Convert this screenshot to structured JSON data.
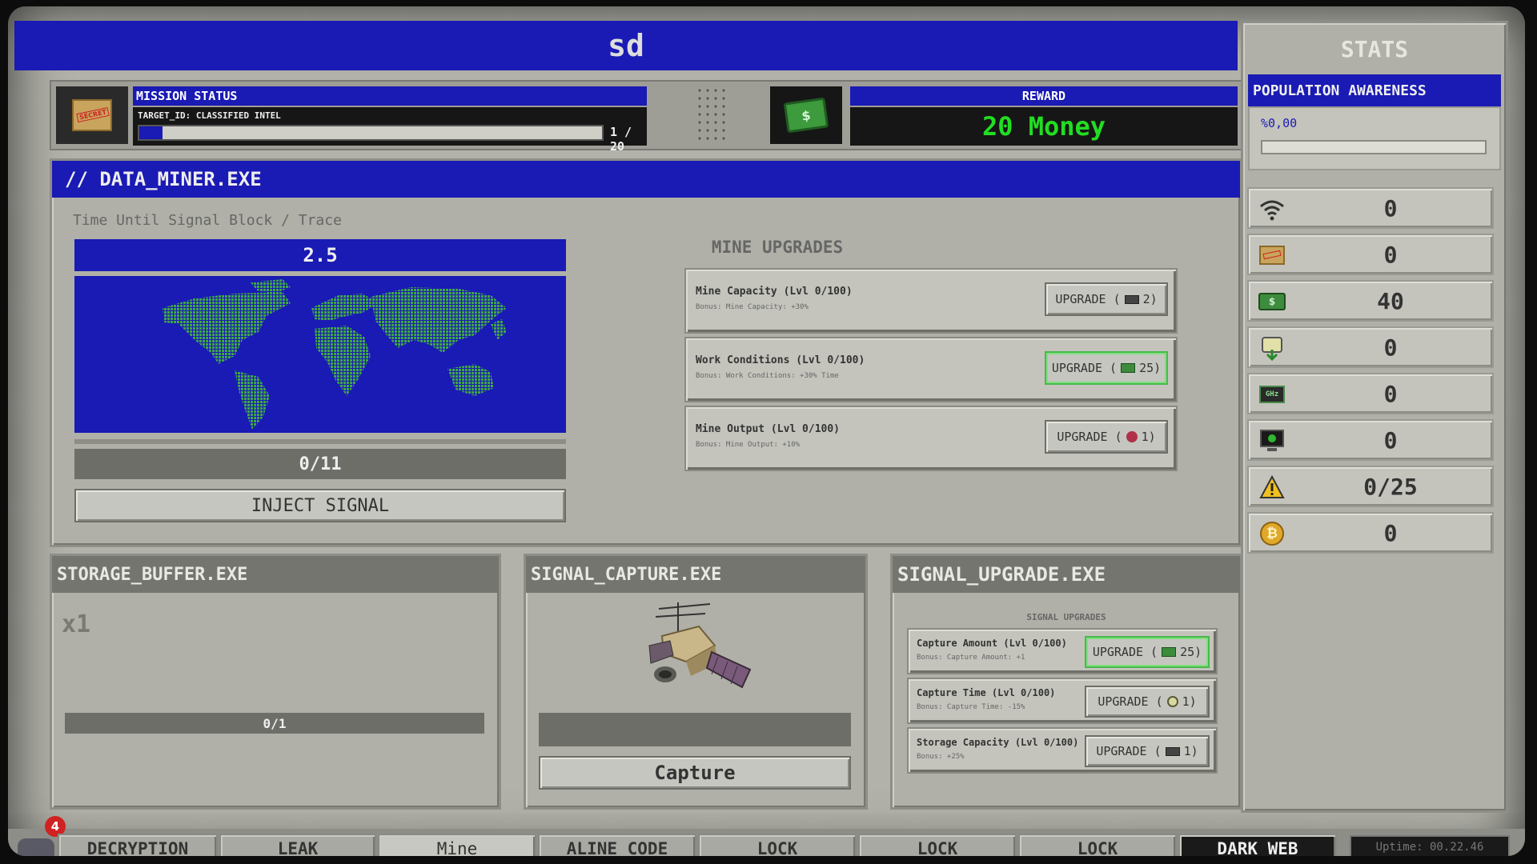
{
  "header": {
    "title": "sd"
  },
  "mission": {
    "label": "MISSION STATUS",
    "target": "TARGET_ID: CLASSIFIED INTEL",
    "progress_text": "1 / 20",
    "progress_fraction": 0.05,
    "reward_label": "REWARD",
    "reward_value": "20 Money"
  },
  "data_miner": {
    "title": "// DATA_MINER.EXE",
    "timer_label": "Time Until Signal Block / Trace",
    "timer_value": "2.5",
    "counter": "0/11",
    "inject_label": "INJECT SIGNAL",
    "upgrades_title": "MINE UPGRADES",
    "upgrades": [
      {
        "title": "Mine Capacity (Lvl 0/100)",
        "bonus": "Bonus: Mine Capacity: +30%",
        "button": "UPGRADE (",
        "cost": "2)",
        "cost_icon": "chip-icon",
        "highlight": false
      },
      {
        "title": "Work Conditions (Lvl 0/100)",
        "bonus": "Bonus: Work Conditions: +30% Time",
        "button": "UPGRADE (",
        "cost": "25)",
        "cost_icon": "money-icon",
        "highlight": true
      },
      {
        "title": "Mine Output (Lvl 0/100)",
        "bonus": "Bonus: Mine Output: +10%",
        "button": "UPGRADE (",
        "cost": "1)",
        "cost_icon": "gem-icon",
        "highlight": false
      }
    ]
  },
  "storage": {
    "title": "STORAGE_BUFFER.EXE",
    "multiplier": "x1",
    "counter": "0/1"
  },
  "capture": {
    "title": "SIGNAL_CAPTURE.EXE",
    "button": "Capture"
  },
  "signal_upgrade": {
    "title": "SIGNAL_UPGRADE.EXE",
    "subtitle": "SIGNAL UPGRADES",
    "upgrades": [
      {
        "title": "Capture Amount (Lvl 0/100)",
        "bonus": "Bonus: Capture Amount: +1",
        "button": "UPGRADE (",
        "cost": "25)",
        "cost_icon": "money-icon",
        "highlight": true
      },
      {
        "title": "Capture Time (Lvl 0/100)",
        "bonus": "Bonus: Capture Time: -15%",
        "button": "UPGRADE (",
        "cost": "1)",
        "cost_icon": "data-icon",
        "highlight": false
      },
      {
        "title": "Storage Capacity (Lvl 0/100)",
        "bonus": "Bonus: +25%",
        "button": "UPGRADE (",
        "cost": "1)",
        "cost_icon": "chip-icon",
        "highlight": false
      }
    ]
  },
  "stats": {
    "title": "STATS",
    "awareness_title": "POPULATION AWARENESS",
    "awareness_value": "%0,00",
    "awareness_fraction": 0.0,
    "rows": [
      {
        "icon": "wifi-icon",
        "value": "0"
      },
      {
        "icon": "classified-folder-icon",
        "value": "0"
      },
      {
        "icon": "money-icon",
        "value": "40"
      },
      {
        "icon": "data-download-icon",
        "value": "0"
      },
      {
        "icon": "cpu-chip-icon",
        "value": "0"
      },
      {
        "icon": "monitor-icon",
        "value": "0"
      },
      {
        "icon": "warning-icon",
        "value": "0/25"
      },
      {
        "icon": "bitcoin-icon",
        "value": "0"
      }
    ]
  },
  "taskbar": {
    "badge": "4",
    "tabs": [
      "DECRYPTION",
      "LEAK",
      "Mine",
      "ALINE CODE",
      "LOCK",
      "LOCK",
      "LOCK",
      "DARK WEB"
    ],
    "uptime": "Uptime: 00.22.46"
  },
  "colors": {
    "accent_blue": "#1a1ab4",
    "money_green": "#22dd22",
    "panel_gray": "#b0b0a8"
  }
}
